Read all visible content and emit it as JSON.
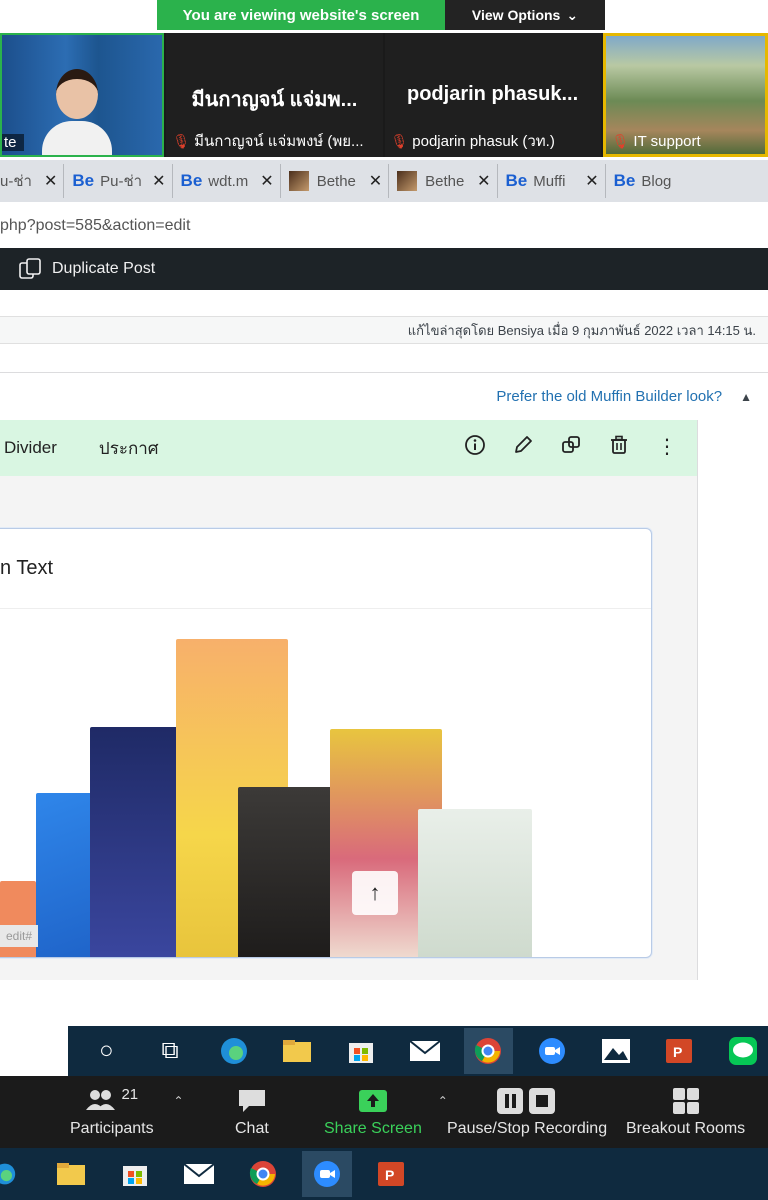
{
  "share_banner": {
    "message": "You are viewing website's screen",
    "options_label": "View Options",
    "options_icon": "chevron-down-icon"
  },
  "participants_strip": {
    "speaker_name_fragment": "te",
    "tiles": [
      {
        "big_name": "มีนกาญจน์ แจ่มพ...",
        "small_name": "มีนกาญจน์ แจ่มพงษ์ (พย..."
      },
      {
        "big_name": "podjarin  phasuk...",
        "small_name": "podjarin phasuk (วท.)"
      },
      {
        "small_name": "IT support"
      }
    ]
  },
  "browser_tabs": [
    {
      "label": "u-ช่า",
      "icon": "page-thumbnail"
    },
    {
      "label": "Pu-ช่า",
      "icon": "be-icon"
    },
    {
      "label": "wdt.m",
      "icon": "be-icon"
    },
    {
      "label": "Bethe",
      "icon": "page-thumbnail"
    },
    {
      "label": "Bethe",
      "icon": "page-thumbnail"
    },
    {
      "label": "Muffi",
      "icon": "be-icon"
    },
    {
      "label": "Blog",
      "icon": "be-icon"
    }
  ],
  "browser_be_label": "Be",
  "url": "php?post=585&action=edit",
  "admin_bar": {
    "duplicate_label": "Duplicate Post"
  },
  "last_edit": "แก้ไขล่าสุดโดย Bensiya เมื่อ 9 กุมภาพันธ์ 2022 เวลา 14:15 น.",
  "muffin_header": {
    "prefer_old_link": "Prefer the old Muffin Builder look?",
    "collapse_icon": "triangle-up-icon"
  },
  "section_bar": {
    "type_label": "Divider",
    "title": "ประกาศ",
    "icons": [
      "info-icon",
      "pencil-icon",
      "duplicate-icon",
      "trash-icon",
      "more-vertical-icon"
    ]
  },
  "card": {
    "title_fragment": "n Text",
    "edit_badge": "edit#",
    "up_icon": "arrow-up-icon"
  },
  "zoom_controls": {
    "participants_label": "Participants",
    "participants_count": "21",
    "chat_label": "Chat",
    "share_label": "Share Screen",
    "recording_label": "Pause/Stop Recording",
    "breakout_label": "Breakout Rooms"
  },
  "colors": {
    "zoom_green": "#2bb24c",
    "wp_admin_dark": "#1d2327",
    "link_blue": "#2271b1",
    "section_green": "#d9f6e2",
    "taskbar_blue": "#0f2a3f"
  }
}
